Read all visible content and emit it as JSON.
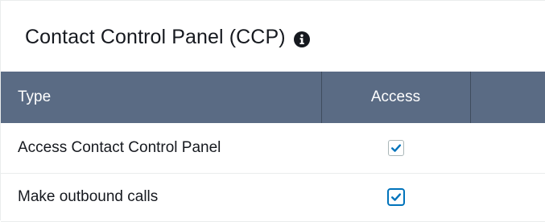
{
  "panel": {
    "title": "Contact Control Panel (CCP)",
    "info_icon": "info-circle-icon"
  },
  "table": {
    "columns": [
      "Type",
      "Access",
      ""
    ],
    "rows": [
      {
        "type": "Access Contact Control Panel",
        "access_checked": true
      },
      {
        "type": "Make outbound calls",
        "access_checked": true
      }
    ]
  },
  "colors": {
    "header_bg": "#5a6b84",
    "header_text": "#ffffff",
    "check_color": "#0073bb",
    "row_divider": "#eaeded",
    "text": "#16191f"
  },
  "icons": {
    "checkbox_mark": "checkmark-icon"
  }
}
